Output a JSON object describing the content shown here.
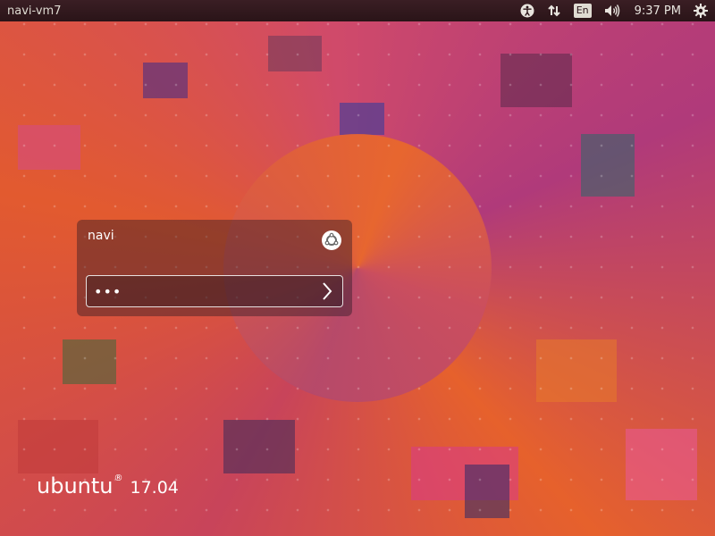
{
  "topbar": {
    "hostname": "navi-vm7",
    "language": "En",
    "clock": "9:37 PM",
    "icons": [
      "accessibility-icon",
      "network-icon",
      "keyboard-layout-icon",
      "volume-icon",
      "settings-gear-icon"
    ]
  },
  "login": {
    "username": "navi",
    "password_masked": "•••",
    "session_icon": "ubuntu-session-icon",
    "submit_icon": "chevron-right-icon"
  },
  "branding": {
    "distro": "ubuntu",
    "registered": "®",
    "version": "17.04"
  },
  "colors": {
    "topbar": "#2a1418",
    "wallpaper_primary": "#c8445a",
    "wallpaper_orange": "#e25a2f",
    "text": "#ffffff"
  }
}
